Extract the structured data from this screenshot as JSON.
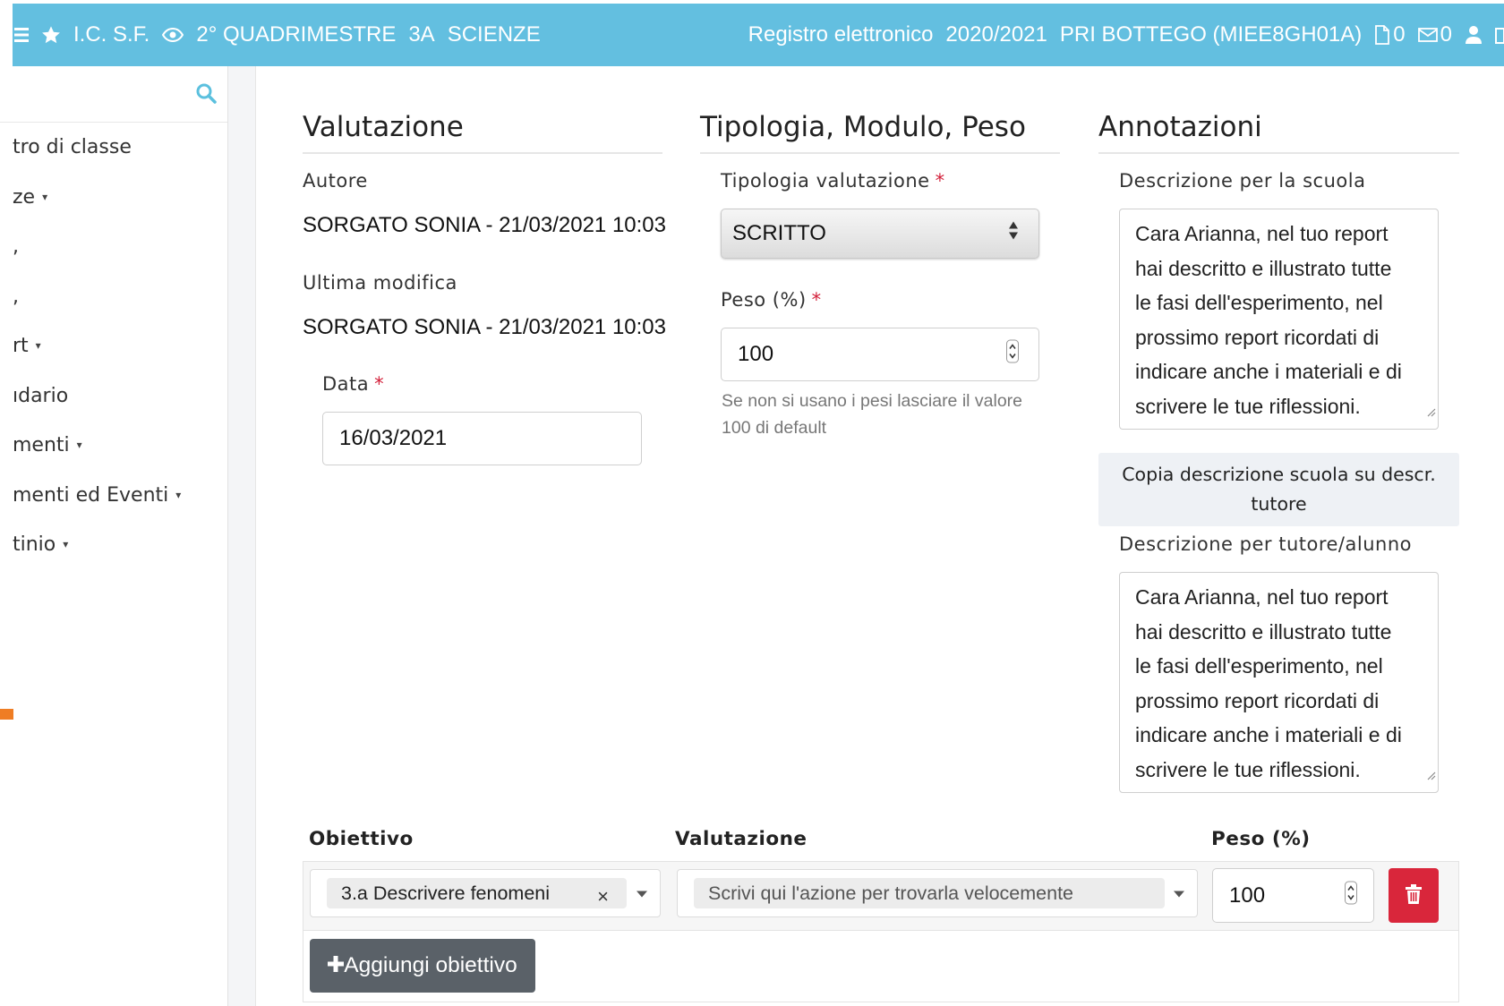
{
  "topbar": {
    "school": "I.C. S.F.",
    "period": "2° QUADRIMESTRE",
    "class": "3A",
    "subject": "SCIENZE",
    "app_name": "Registro elettronico",
    "year": "2020/2021",
    "institute": "PRI BOTTEGO (MIEE8GH01A)",
    "docs_count": "0",
    "mail_count": "0"
  },
  "sidebar": {
    "items": [
      {
        "label": "tro di classe"
      },
      {
        "label": "ze",
        "caret": "▾"
      },
      {
        "label": ","
      },
      {
        "label": ","
      },
      {
        "label": "rt",
        "caret": "▾"
      },
      {
        "label": "ıdario"
      },
      {
        "label": "menti",
        "caret": "▾"
      },
      {
        "label": "menti ed Eventi",
        "caret": "▾"
      },
      {
        "label": "tinio",
        "caret": "▾"
      }
    ]
  },
  "valutazione": {
    "title": "Valutazione",
    "autore_label": "Autore",
    "autore_value": "SORGATO SONIA - 21/03/2021 10:03",
    "modifica_label": "Ultima modifica",
    "modifica_value": "SORGATO SONIA - 21/03/2021 10:03",
    "data_label": "Data",
    "data_value": "16/03/2021",
    "required_mark": "*"
  },
  "tipologia": {
    "title": "Tipologia, Modulo, Peso",
    "tipo_label": "Tipologia valutazione",
    "tipo_value": "SCRITTO",
    "peso_label": "Peso (%)",
    "peso_value": "100",
    "help_line1": "Se non si usano i pesi lasciare il valore",
    "help_line2": "100 di default"
  },
  "annotazioni": {
    "title": "Annotazioni",
    "scuola_label": "Descrizione per la scuola",
    "scuola_lines": [
      "Cara Arianna, nel tuo report",
      "hai descritto e illustrato tutte",
      "le fasi dell'esperimento, nel",
      "prossimo report ricordati di",
      "indicare anche i materiali e di",
      "scrivere le tue riflessioni."
    ],
    "copy_button_line1": "Copia descrizione scuola su descr.",
    "copy_button_line2": "tutore",
    "tutore_label": "Descrizione per tutore/alunno",
    "tutore_lines": [
      "Cara Arianna, nel tuo report",
      "hai descritto e illustrato tutte",
      "le fasi dell'esperimento, nel",
      "prossimo report ricordati di",
      "indicare anche i materiali e di",
      "scrivere le tue riflessioni."
    ]
  },
  "obiettivi": {
    "col_obiettivo": "Obiettivo",
    "col_valutazione": "Valutazione",
    "col_peso": "Peso (%)",
    "row": {
      "obiettivo": "3.a Descrivere fenomeni",
      "clear": "×",
      "valutazione_placeholder": "Scrivi qui l'azione per trovarla velocemente",
      "peso": "100"
    },
    "add_button": "Aggiungi obiettivo"
  },
  "colors": {
    "topbar": "#63bfe0",
    "delete": "#d9263b",
    "add_button": "#5a6168",
    "required": "#d3203a",
    "accent_orange": "#ef7d24"
  }
}
